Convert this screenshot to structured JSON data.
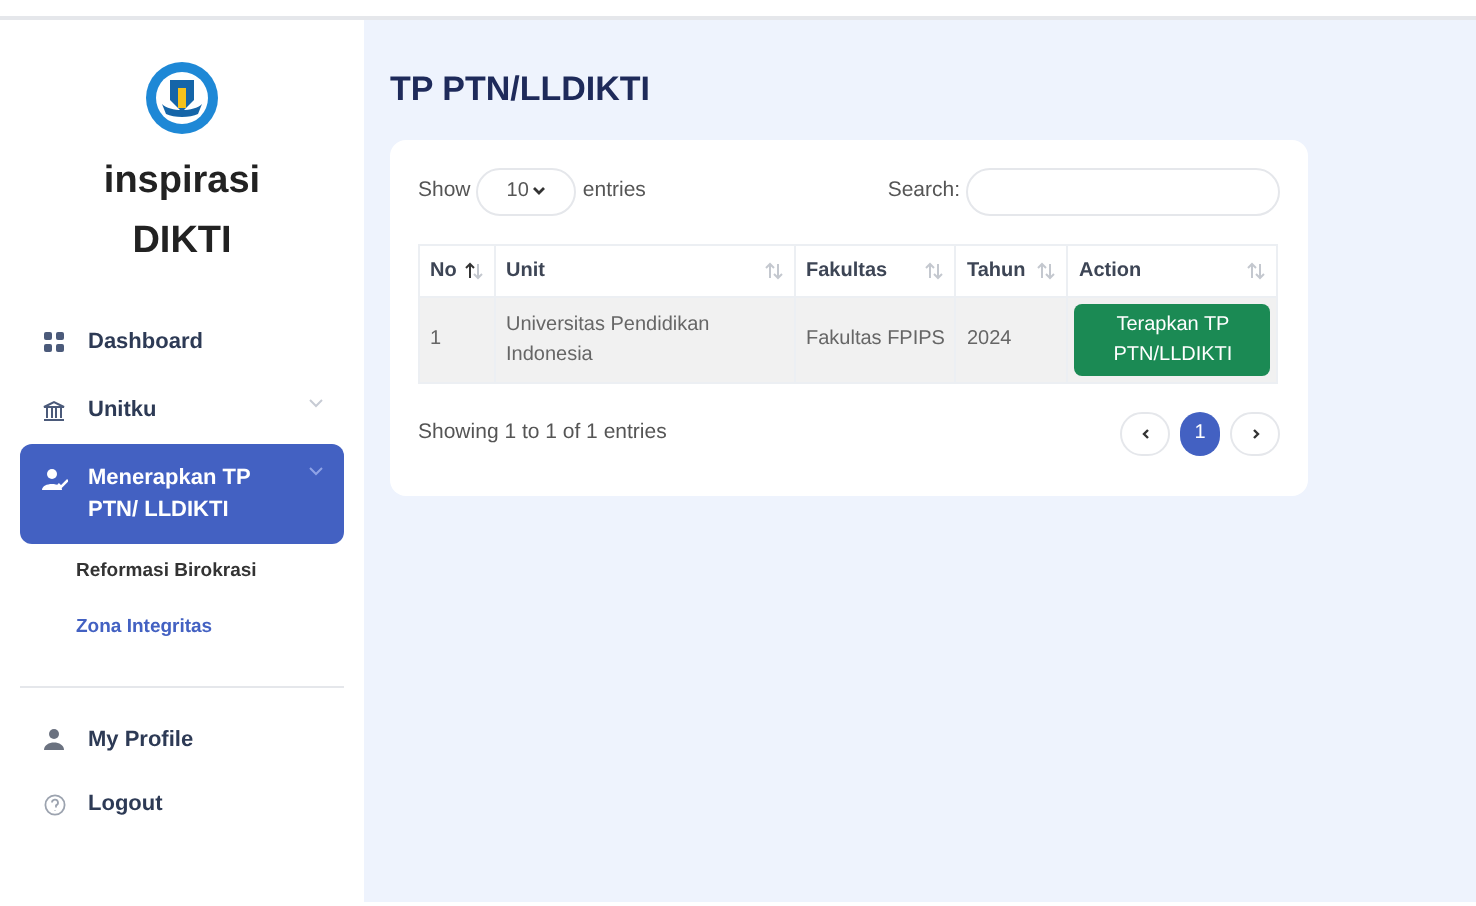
{
  "brand": {
    "line_1": "inspirasi",
    "line_2": "DIKTI"
  },
  "sidebar": {
    "items": [
      {
        "label": "Dashboard",
        "selected": false
      },
      {
        "label": "Unitku",
        "selected": false,
        "expanded": false
      },
      {
        "label": "Menerapkan TP PTN/ LLDIKTI",
        "selected": true,
        "expanded": true,
        "children": [
          {
            "label": "Reformasi Birokrasi",
            "selected": false
          },
          {
            "label": "Zona Integritas",
            "selected": true
          }
        ]
      }
    ],
    "account_items": [
      {
        "label": "My Profile"
      },
      {
        "label": "Logout"
      }
    ]
  },
  "page_title": "TP PTN/LLDIKTI",
  "table_controls": {
    "show_label": "Show",
    "page_size": "10",
    "entries_label": "entries",
    "search_label": "Search:"
  },
  "table": {
    "columns": [
      {
        "label": "No",
        "sorted_ascending": true
      },
      {
        "label": "Unit",
        "sorted_ascending": false
      },
      {
        "label": "Fakultas",
        "sorted_ascending": false
      },
      {
        "label": "Tahun",
        "sorted_ascending": false
      },
      {
        "label": "Action",
        "sorted_ascending": false
      }
    ],
    "rows": [
      {
        "no": "1",
        "unit": "Universitas Pendidikan Indonesia",
        "fakultas": "Fakultas FPIPS",
        "tahun": "2024",
        "action": "Terapkan TP PTN/LLDIKTI"
      }
    ]
  },
  "footer": {
    "info": "Showing 1 to 1 of 1 entries",
    "pages": [
      {
        "label": "1",
        "selected": true
      }
    ]
  }
}
